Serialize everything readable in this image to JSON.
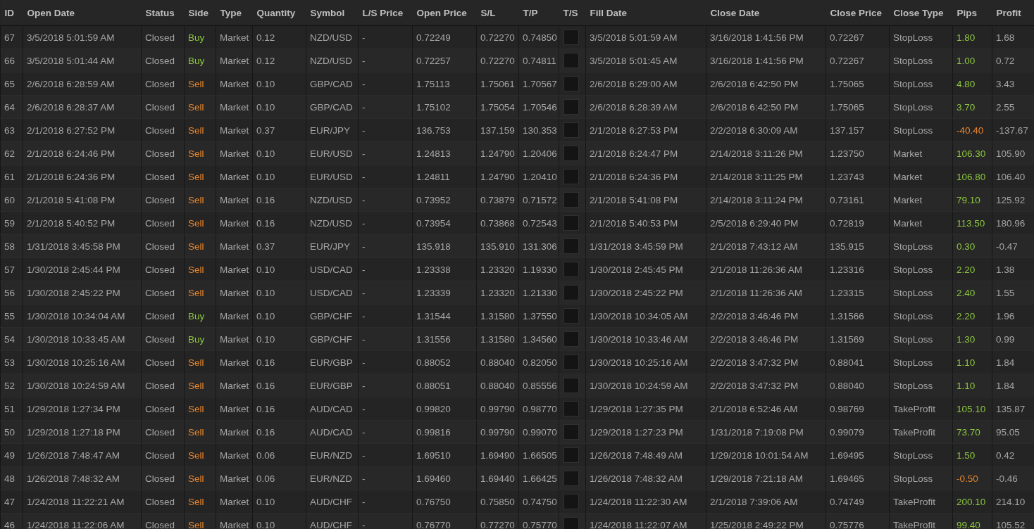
{
  "table": {
    "columns": [
      "ID",
      "Open Date",
      "Status",
      "Side",
      "Type",
      "Quantity",
      "Symbol",
      "L/S Price",
      "Open Price",
      "S/L",
      "T/P",
      "T/S",
      "Fill Date",
      "Close Date",
      "Close Price",
      "Close Type",
      "Pips",
      "Profit"
    ],
    "rows": [
      {
        "id": "67",
        "open_date": "3/5/2018 5:01:59 AM",
        "status": "Closed",
        "side": {
          "text": "Buy",
          "color": "#8cc63f"
        },
        "type": "Market",
        "quantity": "0.12",
        "symbol": "NZD/USD",
        "ls_price": "-",
        "open_price": "0.72249",
        "sl": "0.72270",
        "tp": "0.74850",
        "ts_checked": false,
        "fill_date": "3/5/2018 5:01:59 AM",
        "close_date": "3/16/2018 1:41:56 PM",
        "close_price": "0.72267",
        "close_type": "StopLoss",
        "pips": {
          "text": "1.80",
          "color": "#8cc63f"
        },
        "profit": "1.68"
      },
      {
        "id": "66",
        "open_date": "3/5/2018 5:01:44 AM",
        "status": "Closed",
        "side": {
          "text": "Buy",
          "color": "#8cc63f"
        },
        "type": "Market",
        "quantity": "0.12",
        "symbol": "NZD/USD",
        "ls_price": "-",
        "open_price": "0.72257",
        "sl": "0.72270",
        "tp": "0.74811",
        "ts_checked": false,
        "fill_date": "3/5/2018 5:01:45 AM",
        "close_date": "3/16/2018 1:41:56 PM",
        "close_price": "0.72267",
        "close_type": "StopLoss",
        "pips": {
          "text": "1.00",
          "color": "#8cc63f"
        },
        "profit": "0.72"
      },
      {
        "id": "65",
        "open_date": "2/6/2018 6:28:59 AM",
        "status": "Closed",
        "side": {
          "text": "Sell",
          "color": "#e8862e"
        },
        "type": "Market",
        "quantity": "0.10",
        "symbol": "GBP/CAD",
        "ls_price": "-",
        "open_price": "1.75113",
        "sl": "1.75061",
        "tp": "1.70567",
        "ts_checked": false,
        "fill_date": "2/6/2018 6:29:00 AM",
        "close_date": "2/6/2018 6:42:50 PM",
        "close_price": "1.75065",
        "close_type": "StopLoss",
        "pips": {
          "text": "4.80",
          "color": "#8cc63f"
        },
        "profit": "3.43"
      },
      {
        "id": "64",
        "open_date": "2/6/2018 6:28:37 AM",
        "status": "Closed",
        "side": {
          "text": "Sell",
          "color": "#e8862e"
        },
        "type": "Market",
        "quantity": "0.10",
        "symbol": "GBP/CAD",
        "ls_price": "-",
        "open_price": "1.75102",
        "sl": "1.75054",
        "tp": "1.70546",
        "ts_checked": false,
        "fill_date": "2/6/2018 6:28:39 AM",
        "close_date": "2/6/2018 6:42:50 PM",
        "close_price": "1.75065",
        "close_type": "StopLoss",
        "pips": {
          "text": "3.70",
          "color": "#8cc63f"
        },
        "profit": "2.55"
      },
      {
        "id": "63",
        "open_date": "2/1/2018 6:27:52 PM",
        "status": "Closed",
        "side": {
          "text": "Sell",
          "color": "#e8862e"
        },
        "type": "Market",
        "quantity": "0.37",
        "symbol": "EUR/JPY",
        "ls_price": "-",
        "open_price": "136.753",
        "sl": "137.159",
        "tp": "130.353",
        "ts_checked": false,
        "fill_date": "2/1/2018 6:27:53 PM",
        "close_date": "2/2/2018 6:30:09 AM",
        "close_price": "137.157",
        "close_type": "StopLoss",
        "pips": {
          "text": "-40.40",
          "color": "#e8862e"
        },
        "profit": "-137.67"
      },
      {
        "id": "62",
        "open_date": "2/1/2018 6:24:46 PM",
        "status": "Closed",
        "side": {
          "text": "Sell",
          "color": "#e8862e"
        },
        "type": "Market",
        "quantity": "0.10",
        "symbol": "EUR/USD",
        "ls_price": "-",
        "open_price": "1.24813",
        "sl": "1.24790",
        "tp": "1.20406",
        "ts_checked": false,
        "fill_date": "2/1/2018 6:24:47 PM",
        "close_date": "2/14/2018 3:11:26 PM",
        "close_price": "1.23750",
        "close_type": "Market",
        "pips": {
          "text": "106.30",
          "color": "#8cc63f"
        },
        "profit": "105.90"
      },
      {
        "id": "61",
        "open_date": "2/1/2018 6:24:36 PM",
        "status": "Closed",
        "side": {
          "text": "Sell",
          "color": "#e8862e"
        },
        "type": "Market",
        "quantity": "0.10",
        "symbol": "EUR/USD",
        "ls_price": "-",
        "open_price": "1.24811",
        "sl": "1.24790",
        "tp": "1.20410",
        "ts_checked": false,
        "fill_date": "2/1/2018 6:24:36 PM",
        "close_date": "2/14/2018 3:11:25 PM",
        "close_price": "1.23743",
        "close_type": "Market",
        "pips": {
          "text": "106.80",
          "color": "#8cc63f"
        },
        "profit": "106.40"
      },
      {
        "id": "60",
        "open_date": "2/1/2018 5:41:08 PM",
        "status": "Closed",
        "side": {
          "text": "Sell",
          "color": "#e8862e"
        },
        "type": "Market",
        "quantity": "0.16",
        "symbol": "NZD/USD",
        "ls_price": "-",
        "open_price": "0.73952",
        "sl": "0.73879",
        "tp": "0.71572",
        "ts_checked": false,
        "fill_date": "2/1/2018 5:41:08 PM",
        "close_date": "2/14/2018 3:11:24 PM",
        "close_price": "0.73161",
        "close_type": "Market",
        "pips": {
          "text": "79.10",
          "color": "#8cc63f"
        },
        "profit": "125.92"
      },
      {
        "id": "59",
        "open_date": "2/1/2018 5:40:52 PM",
        "status": "Closed",
        "side": {
          "text": "Sell",
          "color": "#e8862e"
        },
        "type": "Market",
        "quantity": "0.16",
        "symbol": "NZD/USD",
        "ls_price": "-",
        "open_price": "0.73954",
        "sl": "0.73868",
        "tp": "0.72543",
        "ts_checked": false,
        "fill_date": "2/1/2018 5:40:53 PM",
        "close_date": "2/5/2018 6:29:40 PM",
        "close_price": "0.72819",
        "close_type": "Market",
        "pips": {
          "text": "113.50",
          "color": "#8cc63f"
        },
        "profit": "180.96"
      },
      {
        "id": "58",
        "open_date": "1/31/2018 3:45:58 PM",
        "status": "Closed",
        "side": {
          "text": "Sell",
          "color": "#e8862e"
        },
        "type": "Market",
        "quantity": "0.37",
        "symbol": "EUR/JPY",
        "ls_price": "-",
        "open_price": "135.918",
        "sl": "135.910",
        "tp": "131.306",
        "ts_checked": false,
        "fill_date": "1/31/2018 3:45:59 PM",
        "close_date": "2/1/2018 7:43:12 AM",
        "close_price": "135.915",
        "close_type": "StopLoss",
        "pips": {
          "text": "0.30",
          "color": "#8cc63f"
        },
        "profit": "-0.47"
      },
      {
        "id": "57",
        "open_date": "1/30/2018 2:45:44 PM",
        "status": "Closed",
        "side": {
          "text": "Sell",
          "color": "#e8862e"
        },
        "type": "Market",
        "quantity": "0.10",
        "symbol": "USD/CAD",
        "ls_price": "-",
        "open_price": "1.23338",
        "sl": "1.23320",
        "tp": "1.19330",
        "ts_checked": false,
        "fill_date": "1/30/2018 2:45:45 PM",
        "close_date": "2/1/2018 11:26:36 AM",
        "close_price": "1.23316",
        "close_type": "StopLoss",
        "pips": {
          "text": "2.20",
          "color": "#8cc63f"
        },
        "profit": "1.38"
      },
      {
        "id": "56",
        "open_date": "1/30/2018 2:45:22 PM",
        "status": "Closed",
        "side": {
          "text": "Sell",
          "color": "#e8862e"
        },
        "type": "Market",
        "quantity": "0.10",
        "symbol": "USD/CAD",
        "ls_price": "-",
        "open_price": "1.23339",
        "sl": "1.23320",
        "tp": "1.21330",
        "ts_checked": false,
        "fill_date": "1/30/2018 2:45:22 PM",
        "close_date": "2/1/2018 11:26:36 AM",
        "close_price": "1.23315",
        "close_type": "StopLoss",
        "pips": {
          "text": "2.40",
          "color": "#8cc63f"
        },
        "profit": "1.55"
      },
      {
        "id": "55",
        "open_date": "1/30/2018 10:34:04 AM",
        "status": "Closed",
        "side": {
          "text": "Buy",
          "color": "#8cc63f"
        },
        "type": "Market",
        "quantity": "0.10",
        "symbol": "GBP/CHF",
        "ls_price": "-",
        "open_price": "1.31544",
        "sl": "1.31580",
        "tp": "1.37550",
        "ts_checked": false,
        "fill_date": "1/30/2018 10:34:05 AM",
        "close_date": "2/2/2018 3:46:46 PM",
        "close_price": "1.31566",
        "close_type": "StopLoss",
        "pips": {
          "text": "2.20",
          "color": "#8cc63f"
        },
        "profit": "1.96"
      },
      {
        "id": "54",
        "open_date": "1/30/2018 10:33:45 AM",
        "status": "Closed",
        "side": {
          "text": "Buy",
          "color": "#8cc63f"
        },
        "type": "Market",
        "quantity": "0.10",
        "symbol": "GBP/CHF",
        "ls_price": "-",
        "open_price": "1.31556",
        "sl": "1.31580",
        "tp": "1.34560",
        "ts_checked": false,
        "fill_date": "1/30/2018 10:33:46 AM",
        "close_date": "2/2/2018 3:46:46 PM",
        "close_price": "1.31569",
        "close_type": "StopLoss",
        "pips": {
          "text": "1.30",
          "color": "#8cc63f"
        },
        "profit": "0.99"
      },
      {
        "id": "53",
        "open_date": "1/30/2018 10:25:16 AM",
        "status": "Closed",
        "side": {
          "text": "Sell",
          "color": "#e8862e"
        },
        "type": "Market",
        "quantity": "0.16",
        "symbol": "EUR/GBP",
        "ls_price": "-",
        "open_price": "0.88052",
        "sl": "0.88040",
        "tp": "0.82050",
        "ts_checked": false,
        "fill_date": "1/30/2018 10:25:16 AM",
        "close_date": "2/2/2018 3:47:32 PM",
        "close_price": "0.88041",
        "close_type": "StopLoss",
        "pips": {
          "text": "1.10",
          "color": "#8cc63f"
        },
        "profit": "1.84"
      },
      {
        "id": "52",
        "open_date": "1/30/2018 10:24:59 AM",
        "status": "Closed",
        "side": {
          "text": "Sell",
          "color": "#e8862e"
        },
        "type": "Market",
        "quantity": "0.16",
        "symbol": "EUR/GBP",
        "ls_price": "-",
        "open_price": "0.88051",
        "sl": "0.88040",
        "tp": "0.85556",
        "ts_checked": false,
        "fill_date": "1/30/2018 10:24:59 AM",
        "close_date": "2/2/2018 3:47:32 PM",
        "close_price": "0.88040",
        "close_type": "StopLoss",
        "pips": {
          "text": "1.10",
          "color": "#8cc63f"
        },
        "profit": "1.84"
      },
      {
        "id": "51",
        "open_date": "1/29/2018 1:27:34 PM",
        "status": "Closed",
        "side": {
          "text": "Sell",
          "color": "#e8862e"
        },
        "type": "Market",
        "quantity": "0.16",
        "symbol": "AUD/CAD",
        "ls_price": "-",
        "open_price": "0.99820",
        "sl": "0.99790",
        "tp": "0.98770",
        "ts_checked": false,
        "fill_date": "1/29/2018 1:27:35 PM",
        "close_date": "2/1/2018 6:52:46 AM",
        "close_price": "0.98769",
        "close_type": "TakeProfit",
        "pips": {
          "text": "105.10",
          "color": "#8cc63f"
        },
        "profit": "135.87"
      },
      {
        "id": "50",
        "open_date": "1/29/2018 1:27:18 PM",
        "status": "Closed",
        "side": {
          "text": "Sell",
          "color": "#e8862e"
        },
        "type": "Market",
        "quantity": "0.16",
        "symbol": "AUD/CAD",
        "ls_price": "-",
        "open_price": "0.99816",
        "sl": "0.99790",
        "tp": "0.99070",
        "ts_checked": false,
        "fill_date": "1/29/2018 1:27:23 PM",
        "close_date": "1/31/2018 7:19:08 PM",
        "close_price": "0.99079",
        "close_type": "TakeProfit",
        "pips": {
          "text": "73.70",
          "color": "#8cc63f"
        },
        "profit": "95.05"
      },
      {
        "id": "49",
        "open_date": "1/26/2018 7:48:47 AM",
        "status": "Closed",
        "side": {
          "text": "Sell",
          "color": "#e8862e"
        },
        "type": "Market",
        "quantity": "0.06",
        "symbol": "EUR/NZD",
        "ls_price": "-",
        "open_price": "1.69510",
        "sl": "1.69490",
        "tp": "1.66505",
        "ts_checked": false,
        "fill_date": "1/26/2018 7:48:49 AM",
        "close_date": "1/29/2018 10:01:54 AM",
        "close_price": "1.69495",
        "close_type": "StopLoss",
        "pips": {
          "text": "1.50",
          "color": "#8cc63f"
        },
        "profit": "0.42"
      },
      {
        "id": "48",
        "open_date": "1/26/2018 7:48:32 AM",
        "status": "Closed",
        "side": {
          "text": "Sell",
          "color": "#e8862e"
        },
        "type": "Market",
        "quantity": "0.06",
        "symbol": "EUR/NZD",
        "ls_price": "-",
        "open_price": "1.69460",
        "sl": "1.69440",
        "tp": "1.66425",
        "ts_checked": false,
        "fill_date": "1/26/2018 7:48:32 AM",
        "close_date": "1/29/2018 7:21:18 AM",
        "close_price": "1.69465",
        "close_type": "StopLoss",
        "pips": {
          "text": "-0.50",
          "color": "#e8862e"
        },
        "profit": "-0.46"
      },
      {
        "id": "47",
        "open_date": "1/24/2018 11:22:21 AM",
        "status": "Closed",
        "side": {
          "text": "Sell",
          "color": "#e8862e"
        },
        "type": "Market",
        "quantity": "0.10",
        "symbol": "AUD/CHF",
        "ls_price": "-",
        "open_price": "0.76750",
        "sl": "0.75850",
        "tp": "0.74750",
        "ts_checked": false,
        "fill_date": "1/24/2018 11:22:30 AM",
        "close_date": "2/1/2018 7:39:06 AM",
        "close_price": "0.74749",
        "close_type": "TakeProfit",
        "pips": {
          "text": "200.10",
          "color": "#8cc63f"
        },
        "profit": "214.10"
      },
      {
        "id": "46",
        "open_date": "1/24/2018 11:22:06 AM",
        "status": "Closed",
        "side": {
          "text": "Sell",
          "color": "#e8862e"
        },
        "type": "Market",
        "quantity": "0.10",
        "symbol": "AUD/CHF",
        "ls_price": "-",
        "open_price": "0.76770",
        "sl": "0.77270",
        "tp": "0.75770",
        "ts_checked": false,
        "fill_date": "1/24/2018 11:22:07 AM",
        "close_date": "1/25/2018 2:49:22 PM",
        "close_price": "0.75776",
        "close_type": "TakeProfit",
        "pips": {
          "text": "99.40",
          "color": "#8cc63f"
        },
        "profit": "105.52"
      }
    ]
  }
}
